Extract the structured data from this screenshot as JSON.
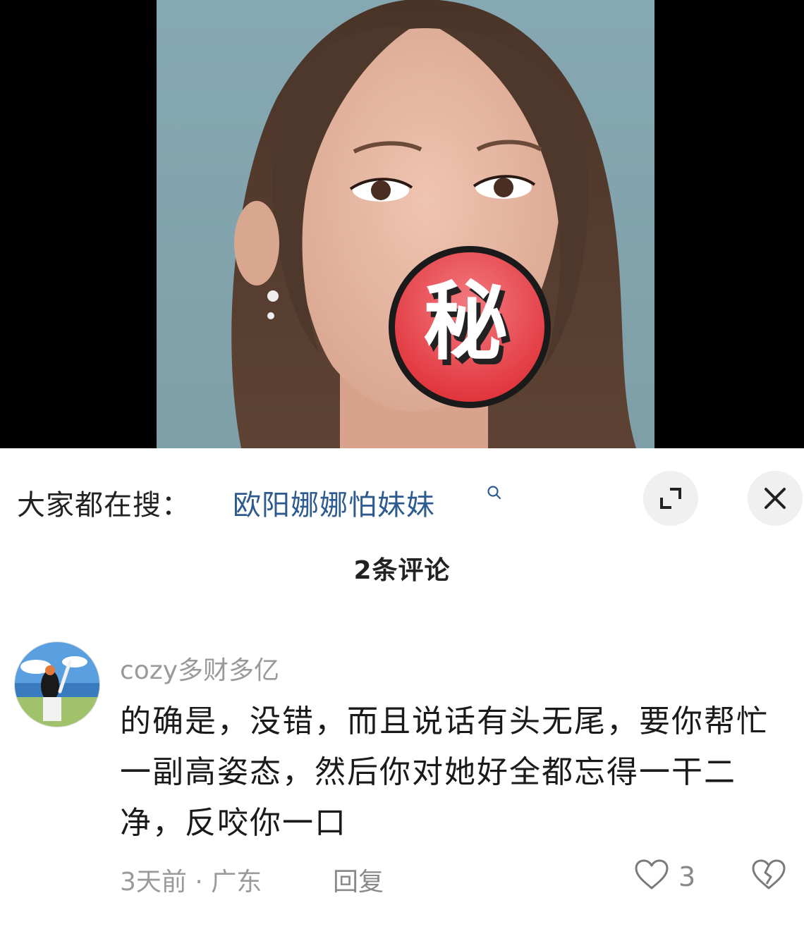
{
  "video": {
    "badge_text": "秘"
  },
  "search": {
    "prefix": "大家都在搜：",
    "term": "欧阳娜娜怕妹妹",
    "term_icon": "search-icon",
    "expand_icon": "expand-icon",
    "close_icon": "close-icon"
  },
  "comments_header": {
    "count_label": "2条评论"
  },
  "comment": {
    "avatar_icon": "user-avatar",
    "username": "cozy多财多亿",
    "text": "的确是，没错，而且说话有头无尾，要你帮忙一副高姿态，然后你对她好全都忘得一干二净，反咬你一口",
    "meta": "3天前 · 广东",
    "reply_label": "回复",
    "like_icon": "heart-icon",
    "like_count": "3",
    "dislike_icon": "broken-heart-icon"
  },
  "colors": {
    "search_term": "#2d5a8f",
    "muted_text": "#9a9a9a",
    "badge_red": "#e8444a"
  }
}
